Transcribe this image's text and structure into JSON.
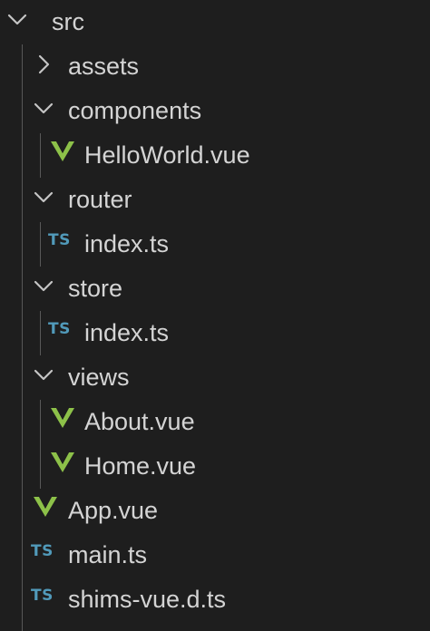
{
  "explorer": {
    "colors": {
      "background": "#1e1e1e",
      "text": "#d4d4d4",
      "vue_icon": "#8dc149",
      "ts_icon": "#519aba",
      "indent_guide": "#585858"
    },
    "items": [
      {
        "label": "src",
        "kind": "folder",
        "state": "expanded",
        "icon": "chevron-down-icon"
      },
      {
        "label": "assets",
        "kind": "folder",
        "state": "collapsed",
        "icon": "chevron-right-icon"
      },
      {
        "label": "components",
        "kind": "folder",
        "state": "expanded",
        "icon": "chevron-down-icon"
      },
      {
        "label": "HelloWorld.vue",
        "kind": "file",
        "icon": "vue-icon"
      },
      {
        "label": "router",
        "kind": "folder",
        "state": "expanded",
        "icon": "chevron-down-icon"
      },
      {
        "label": "index.ts",
        "kind": "file",
        "icon": "ts-icon",
        "icon_text": "TS"
      },
      {
        "label": "store",
        "kind": "folder",
        "state": "expanded",
        "icon": "chevron-down-icon"
      },
      {
        "label": "index.ts",
        "kind": "file",
        "icon": "ts-icon",
        "icon_text": "TS"
      },
      {
        "label": "views",
        "kind": "folder",
        "state": "expanded",
        "icon": "chevron-down-icon"
      },
      {
        "label": "About.vue",
        "kind": "file",
        "icon": "vue-icon"
      },
      {
        "label": "Home.vue",
        "kind": "file",
        "icon": "vue-icon"
      },
      {
        "label": "App.vue",
        "kind": "file",
        "icon": "vue-icon"
      },
      {
        "label": "main.ts",
        "kind": "file",
        "icon": "ts-icon",
        "icon_text": "TS"
      },
      {
        "label": "shims-vue.d.ts",
        "kind": "file",
        "icon": "ts-icon",
        "icon_text": "TS"
      }
    ]
  }
}
